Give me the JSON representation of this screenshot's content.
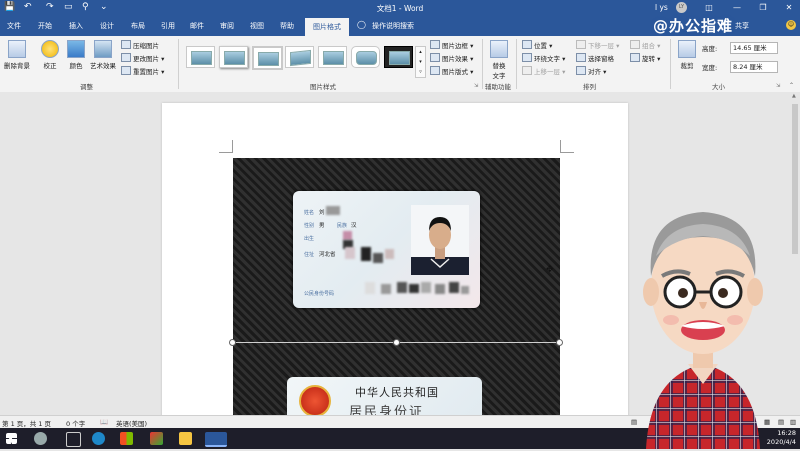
{
  "titlebar": {
    "title": "文档1 - Word",
    "user": "l ys",
    "avatar_initials": "LY",
    "qa_icons": [
      "save-icon",
      "undo-icon",
      "redo-icon",
      "new-doc-icon",
      "print-preview-icon",
      "customize-icon"
    ],
    "window_buttons": [
      "ribbon-display-icon",
      "minimize-icon",
      "restore-icon",
      "close-icon"
    ]
  },
  "tabs": {
    "items": [
      "文件",
      "开始",
      "插入",
      "设计",
      "布局",
      "引用",
      "邮件",
      "审阅",
      "视图",
      "帮助"
    ],
    "active": "图片格式",
    "tell_me": "操作说明搜索",
    "share": "共享"
  },
  "watermark": "@办公指难",
  "ribbon": {
    "adjust": {
      "remove_bg": "删除背景",
      "corrections": "校正",
      "color": "颜色",
      "artistic": "艺术效果",
      "compress": "压缩图片",
      "change": "更改图片",
      "reset": "重置图片",
      "label": "调整"
    },
    "styles": {
      "border": "图片边框",
      "effects": "图片效果",
      "layout": "图片版式",
      "label": "图片样式"
    },
    "accessibility": {
      "alt_text_line1": "替换",
      "alt_text_line2": "文字",
      "label": "辅助功能"
    },
    "arrange": {
      "position": "位置",
      "wrap": "环绕文字",
      "forward": "上移一层",
      "backward": "下移一层",
      "selection_pane": "选择窗格",
      "align": "对齐",
      "group": "组合",
      "rotate": "旋转",
      "label": "排列"
    },
    "size": {
      "crop": "裁剪",
      "height_label": "高度:",
      "height_value": "14.65 厘米",
      "width_label": "宽度:",
      "width_value": "8.24 厘米",
      "label": "大小"
    }
  },
  "idcard_front": {
    "name_label": "姓名",
    "name_value": "刘",
    "sex_label": "性别",
    "sex_value": "男",
    "ethnic_label": "民族",
    "ethnic_value": "汉",
    "birth_label": "出生",
    "address_label": "住址",
    "address_value": "河北省",
    "id_label": "公民身份号码"
  },
  "idcard_back": {
    "title": "中华人民共和国",
    "subtitle": "居民身份证"
  },
  "statusbar": {
    "page": "第 1 页，共 1 页",
    "words": "0 个字",
    "language": "英语(美国)"
  },
  "taskbar": {
    "time": "16:28",
    "date": "2020/4/4"
  }
}
